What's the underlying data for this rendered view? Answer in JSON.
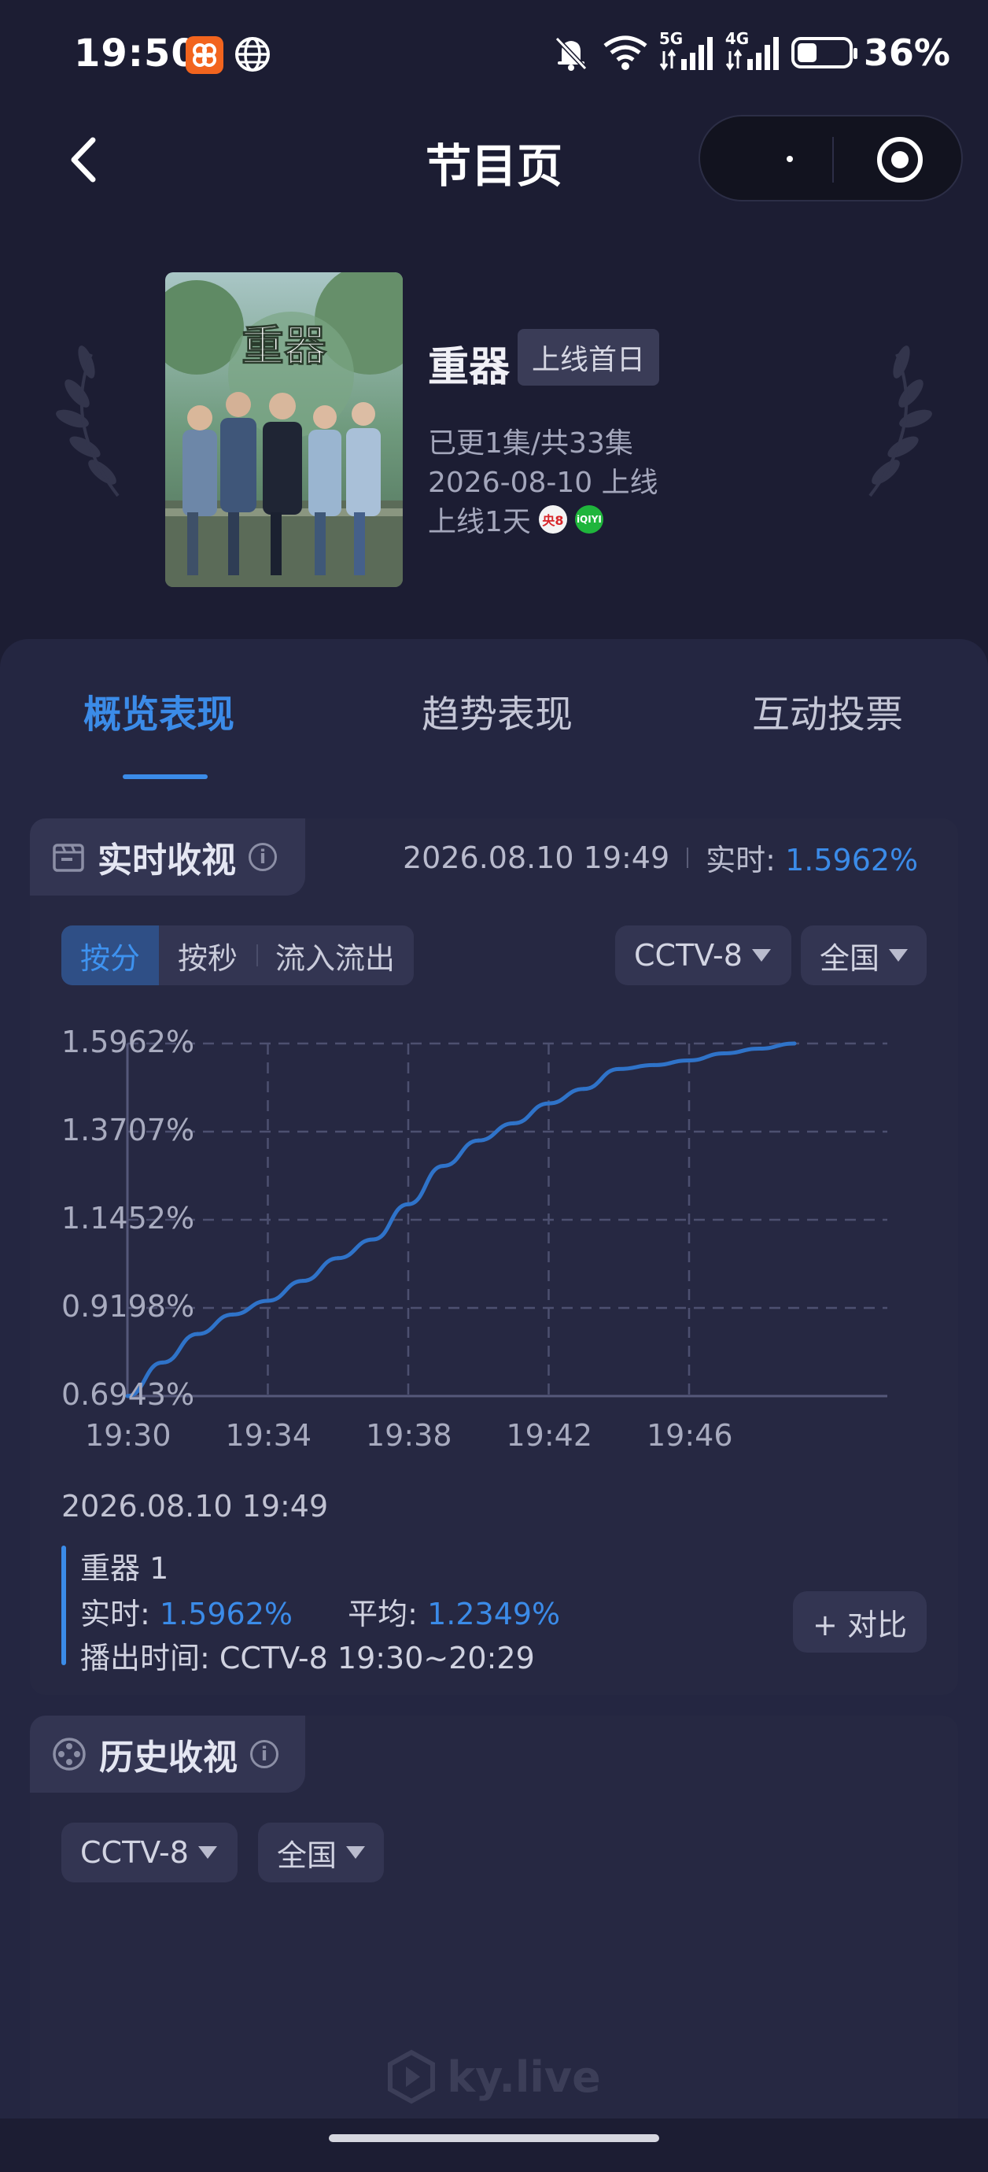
{
  "status_bar": {
    "time": "19:50",
    "network_5g": "5G",
    "network_4g": "4G",
    "battery": "36%"
  },
  "nav": {
    "title": "节目页"
  },
  "program": {
    "name": "重器",
    "poster_title": "重器",
    "badge": "上线首日",
    "episodes": "已更1集/共33集",
    "release": "2026-08-10 上线",
    "online_days": "上线1天",
    "channel_icons": [
      "央8",
      "iQIYI"
    ]
  },
  "tabs": [
    {
      "label": "概览表现",
      "active": true
    },
    {
      "label": "趋势表现",
      "active": false
    },
    {
      "label": "互动投票",
      "active": false
    }
  ],
  "realtime": {
    "title": "实时收视",
    "timestamp": "2026.08.10 19:49",
    "live_label": "实时:",
    "live_value": "1.5962%",
    "segments": [
      "按分",
      "按秒",
      "流入流出"
    ],
    "channel": "CCTV-8",
    "region": "全国"
  },
  "chart_data": {
    "type": "line",
    "title": "",
    "xlabel": "",
    "ylabel": "",
    "x_ticks": [
      "19:30",
      "19:34",
      "19:38",
      "19:42",
      "19:46"
    ],
    "y_ticks": [
      "1.5962%",
      "1.3707%",
      "1.1452%",
      "0.9198%",
      "0.6943%"
    ],
    "ylim": [
      0.6943,
      1.5962
    ],
    "grid": true,
    "series": [
      {
        "name": "重器 1",
        "x": [
          "19:30",
          "19:31",
          "19:32",
          "19:33",
          "19:34",
          "19:35",
          "19:36",
          "19:37",
          "19:38",
          "19:39",
          "19:40",
          "19:41",
          "19:42",
          "19:43",
          "19:44",
          "19:45",
          "19:46",
          "19:47",
          "19:48",
          "19:49"
        ],
        "values": [
          0.6943,
          0.78,
          0.853,
          0.903,
          0.938,
          0.989,
          1.047,
          1.095,
          1.185,
          1.283,
          1.348,
          1.392,
          1.443,
          1.48,
          1.531,
          1.541,
          1.553,
          1.571,
          1.583,
          1.5962
        ],
        "color": "#2f73c9"
      }
    ]
  },
  "detail": {
    "timestamp": "2026.08.10 19:49",
    "series_name": "重器 1",
    "live_label": "实时:",
    "live_value": "1.5962%",
    "avg_label": "平均:",
    "avg_value": "1.2349%",
    "airtime": "播出时间:  CCTV-8 19:30~20:29",
    "compare_button": "+ 对比"
  },
  "history": {
    "title": "历史收视",
    "channel": "CCTV-8",
    "region": "全国"
  },
  "watermark": "ky.live",
  "colors": {
    "accent": "#3b8be8",
    "background": "#1c1d33",
    "card": "#242641"
  }
}
